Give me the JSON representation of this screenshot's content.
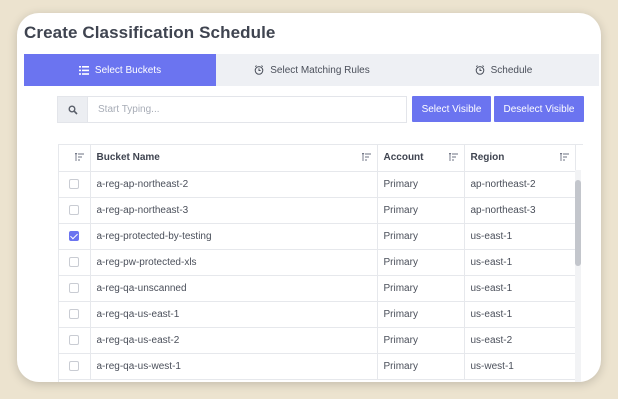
{
  "dialog": {
    "title": "Create Classification Schedule",
    "close_label": "×"
  },
  "tabs": [
    {
      "label": "Select Buckets",
      "icon": "list-icon",
      "active": true
    },
    {
      "label": "Select Matching Rules",
      "icon": "clock-icon",
      "active": false
    },
    {
      "label": "Schedule",
      "icon": "clock-icon",
      "active": false
    }
  ],
  "search": {
    "placeholder": "Start Typing...",
    "value": ""
  },
  "buttons": {
    "select_visible": "Select Visible",
    "deselect_visible": "Deselect Visible"
  },
  "table": {
    "columns": [
      "Bucket Name",
      "Account",
      "Region"
    ],
    "rows": [
      {
        "checked": false,
        "bucket": "a-reg-ap-northeast-2",
        "account": "Primary",
        "region": "ap-northeast-2"
      },
      {
        "checked": false,
        "bucket": "a-reg-ap-northeast-3",
        "account": "Primary",
        "region": "ap-northeast-3"
      },
      {
        "checked": true,
        "bucket": "a-reg-protected-by-testing",
        "account": "Primary",
        "region": "us-east-1"
      },
      {
        "checked": false,
        "bucket": "a-reg-pw-protected-xls",
        "account": "Primary",
        "region": "us-east-1"
      },
      {
        "checked": false,
        "bucket": "a-reg-qa-unscanned",
        "account": "Primary",
        "region": "us-east-1"
      },
      {
        "checked": false,
        "bucket": "a-reg-qa-us-east-1",
        "account": "Primary",
        "region": "us-east-1"
      },
      {
        "checked": false,
        "bucket": "a-reg-qa-us-east-2",
        "account": "Primary",
        "region": "us-east-2"
      },
      {
        "checked": false,
        "bucket": "a-reg-qa-us-west-1",
        "account": "Primary",
        "region": "us-west-1"
      }
    ]
  },
  "colors": {
    "accent": "#6b74f0",
    "background": "#ece3cf"
  }
}
